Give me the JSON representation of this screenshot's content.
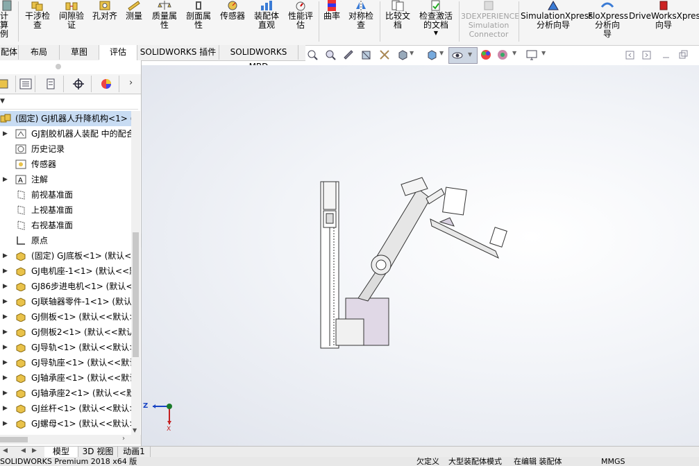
{
  "ribbon": {
    "partial_left": "计算\n例",
    "buttons": [
      {
        "label": "干涉检\n查",
        "icon": "interference-check-icon"
      },
      {
        "label": "间隙验\n证",
        "icon": "clearance-verify-icon"
      },
      {
        "label": "孔对齐",
        "icon": "hole-alignment-icon"
      },
      {
        "label": "测量",
        "icon": "measure-icon"
      },
      {
        "label": "质量属\n性",
        "icon": "mass-properties-icon"
      },
      {
        "label": "剖面属\n性",
        "icon": "section-properties-icon"
      },
      {
        "label": "传感器",
        "icon": "sensor-icon"
      },
      {
        "label": "装配体\n直观",
        "icon": "assemblyxpert-icon"
      },
      {
        "label": "性能评\n估",
        "icon": "performance-eval-icon"
      },
      {
        "label": "曲率",
        "icon": "curvature-icon"
      },
      {
        "label": "对称检\n查",
        "icon": "symmetry-check-icon"
      },
      {
        "label": "比较文\n档",
        "icon": "compare-docs-icon"
      },
      {
        "label": "检查激活\n的文档",
        "icon": "check-active-doc-icon"
      },
      {
        "label": "3DEXPERIENCE\nSimulation\nConnector",
        "icon": "3dexperience-icon",
        "disabled": true
      },
      {
        "label": "SimulationXpress\n分析向导",
        "icon": "simulationxpress-icon"
      },
      {
        "label": "FloXpress\n分析向\n导",
        "icon": "floxpress-icon"
      },
      {
        "label": "DriveWorksXpress\n向导",
        "icon": "driveworksxpress-icon"
      }
    ]
  },
  "tabs": [
    "配体",
    "布局",
    "草图",
    "评估",
    "SOLIDWORKS 插件",
    "SOLIDWORKS MBD"
  ],
  "active_tab": "评估",
  "tree": {
    "root": "(固定) GJ机器人升降机构<1> (",
    "items": [
      {
        "label": "GJ割胶机器人装配 中的配合",
        "icon": "mates-icon",
        "expand": "▶"
      },
      {
        "label": "历史记录",
        "icon": "history-icon",
        "expand": ""
      },
      {
        "label": "传感器",
        "icon": "sensor-icon",
        "expand": ""
      },
      {
        "label": "注解",
        "icon": "annotation-icon",
        "expand": "▶"
      },
      {
        "label": "前视基准面",
        "icon": "plane-icon",
        "expand": ""
      },
      {
        "label": "上视基准面",
        "icon": "plane-icon",
        "expand": ""
      },
      {
        "label": "右视基准面",
        "icon": "plane-icon",
        "expand": ""
      },
      {
        "label": "原点",
        "icon": "origin-icon",
        "expand": ""
      },
      {
        "label": "(固定) GJ底板<1> (默认<",
        "icon": "part-icon",
        "expand": "▶"
      },
      {
        "label": "GJ电机座-1<1> (默认<<默",
        "icon": "part-icon",
        "expand": "▶"
      },
      {
        "label": "GJ86步进电机<1> (默认<",
        "icon": "part-icon",
        "expand": "▶"
      },
      {
        "label": "GJ联轴器零件-1<1> (默认",
        "icon": "part-icon",
        "expand": "▶"
      },
      {
        "label": "GJ侧板<1> (默认<<默认>",
        "icon": "part-icon",
        "expand": "▶"
      },
      {
        "label": "GJ侧板2<1> (默认<<默认>",
        "icon": "part-icon",
        "expand": "▶"
      },
      {
        "label": "GJ导轨<1> (默认<<默认>",
        "icon": "part-icon",
        "expand": "▶"
      },
      {
        "label": "GJ导轨座<1> (默认<<默认",
        "icon": "part-icon",
        "expand": "▶"
      },
      {
        "label": "GJ轴承座<1> (默认<<默认",
        "icon": "part-icon",
        "expand": "▶"
      },
      {
        "label": "GJ轴承座2<1> (默认<<默",
        "icon": "part-icon",
        "expand": "▶"
      },
      {
        "label": "GJ丝杆<1> (默认<<默认>",
        "icon": "part-icon",
        "expand": "▶"
      },
      {
        "label": "GJ螺母<1> (默认<<默认>",
        "icon": "part-icon",
        "expand": "▶"
      }
    ]
  },
  "triad": {
    "z": "Z",
    "x": "X"
  },
  "bottom_tabs": [
    "模型",
    "3D 视图",
    "动画1"
  ],
  "active_bottom_tab": "模型",
  "status": {
    "version": "SOLIDWORKS Premium 2018 x64 版",
    "define": "欠定义",
    "mode": "大型装配体模式",
    "editing": "在编辑 装配体",
    "units": "MMGS"
  }
}
